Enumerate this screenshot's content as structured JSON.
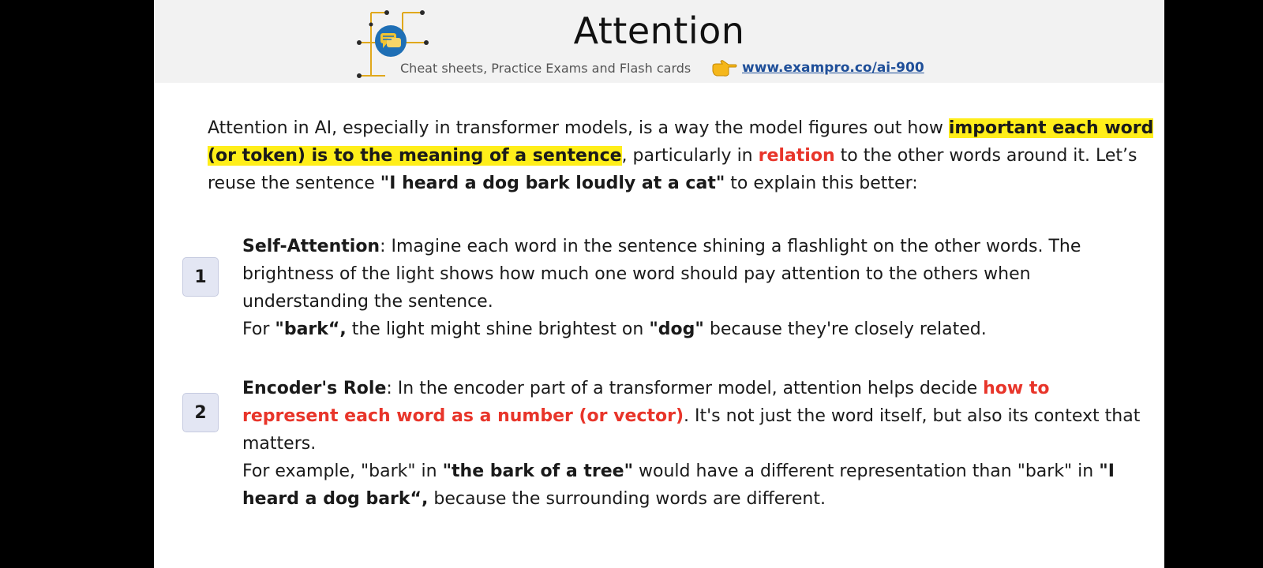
{
  "header": {
    "title": "Attention",
    "tagline": "Cheat sheets, Practice Exams and Flash cards",
    "link": "www.exampro.co/ai-900",
    "icons": {
      "logo": "chat-bubble-circuit-logo",
      "pointer": "pointing-hand-icon"
    }
  },
  "intro": {
    "t1": "Attention in AI, especially in transformer models, is a way the model figures out how ",
    "hl": "important each word (or token) is to the meaning of a sentence",
    "t2": ", particularly in ",
    "red": "relation",
    "t3": " to the other words around it. Let’s reuse the sentence ",
    "quote": "\"I heard a dog bark loudly at a cat\"",
    "t4": " to explain this better:"
  },
  "items": [
    {
      "number": "1",
      "term": "Self-Attention",
      "t1": ": Imagine each word in the sentence shining a flashlight on the other words. The brightness of the light shows how much one word should pay attention to the others when understanding the sentence.",
      "t2": "For ",
      "b1": "\"bark“,",
      "t3": " the light might shine brightest on ",
      "b2": "\"dog\"",
      "t4": " because they're closely related."
    },
    {
      "number": "2",
      "term": "Encoder's Role",
      "t1": ": In the encoder part of a transformer model, attention helps decide ",
      "red": "how to represent each word as a number (or vector)",
      "t2": ". It's not just the word itself, but also its context that matters.",
      "t3": "For example, \"bark\" in ",
      "b1": "\"the bark of a tree\"",
      "t4": " would have a different representation than \"bark\" in ",
      "b2": "\"I heard a dog bark“,",
      "t5": " because the surrounding words are different."
    }
  ],
  "colors": {
    "highlight": "#ffee1a",
    "accent_red": "#e8352a",
    "link_blue": "#1f4f99",
    "badge_bg": "#e3e6f3",
    "header_bg": "#f2f2f2"
  }
}
